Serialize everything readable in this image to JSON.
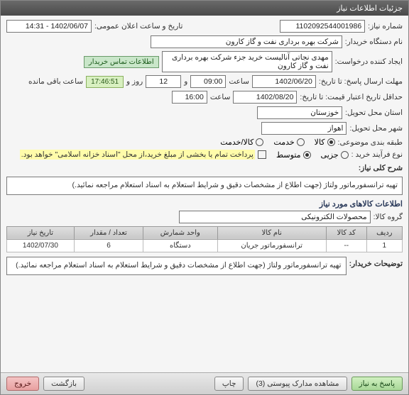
{
  "window": {
    "title": "جزئیات اطلاعات نیاز"
  },
  "fields": {
    "need_no_label": "شماره نیاز:",
    "need_no": "1102092544001986",
    "announce_label": "تاریخ و ساعت اعلان عمومی:",
    "announce": "1402/06/07 - 14:31",
    "buyer_org_label": "نام دستگاه خریدار:",
    "buyer_org": "شرکت بهره برداری نفت و گاز کارون",
    "creator_label": "ایجاد کننده درخواست:",
    "creator": "مهدی نجاتی آنالیست خرید جزء شرکت بهره برداری نفت و گاز کارون",
    "contact_btn": "اطلاعات تماس خریدار",
    "deadline_label": "مهلت ارسال پاسخ: تا تاریخ:",
    "deadline_date": "1402/06/20",
    "deadline_time_label": "ساعت",
    "deadline_time": "09:00",
    "days_and": "و",
    "days": "12",
    "days_label": "روز و",
    "remaining": "17:46:51",
    "remaining_label": "ساعت باقی مانده",
    "validity_label": "حداقل تاریخ اعتبار قیمت: تا تاریخ:",
    "validity_date": "1402/08/20",
    "validity_time_label": "ساعت",
    "validity_time": "16:00",
    "province_label": "استان محل تحویل:",
    "province": "خوزستان",
    "city_label": "شهر محل تحویل:",
    "city": "اهواز",
    "category_label": "طبقه بندی موضوعی:",
    "cat_goods": "کالا",
    "cat_service": "خدمت",
    "cat_both": "کالا/خدمت",
    "process_label": "نوع فرآیند خرید :",
    "proc_small": "جزیی",
    "proc_medium": "متوسط",
    "pay_note": "پرداخت تمام یا بخشی از مبلغ خرید،از محل \"اسناد خزانه اسلامی\" خواهد بود.",
    "desc_label": "شرح کلی نیاز:",
    "desc": "تهیه ترانسفورماتور ولتاژ (جهت اطلاع از مشخصات دقیق و شرایط استعلام به اسناد استعلام مراجعه نمائید.)",
    "items_title": "اطلاعات کالاهای مورد نیاز",
    "group_label": "گروه کالا:",
    "group": "محصولات الکترونیکی",
    "buyer_notes_label": "توضیحات خریدار:",
    "buyer_notes": "تهیه ترانسفورماتور ولتاژ (جهت اطلاع از مشخصات دقیق و شرایط استعلام به اسناد استعلام مراجعه نمائید.)"
  },
  "table": {
    "headers": {
      "row": "ردیف",
      "code": "کد کالا",
      "name": "نام کالا",
      "unit": "واحد شمارش",
      "qty": "تعداد / مقدار",
      "date": "تاریخ نیاز"
    },
    "rows": [
      {
        "row": "1",
        "code": "--",
        "name": "ترانسفورماتور جریان",
        "unit": "دستگاه",
        "qty": "6",
        "date": "1402/07/30"
      }
    ]
  },
  "footer": {
    "respond": "پاسخ به نیاز",
    "attachments": "مشاهده مدارک پیوستی (3)",
    "print": "چاپ",
    "back": "بازگشت",
    "exit": "خروج"
  }
}
